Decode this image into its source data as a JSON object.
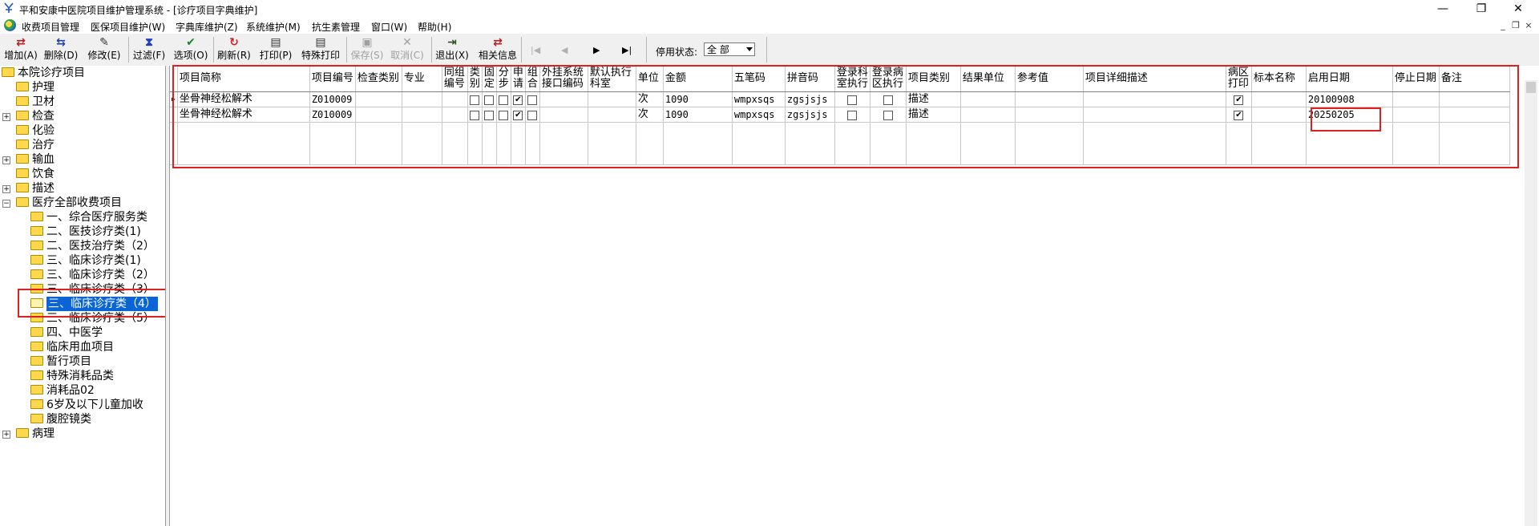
{
  "window": {
    "title": "平和安康中医院项目维护管理系统 - [诊疗项目字典维护]",
    "minimize": "—",
    "restore": "❐",
    "close": "✕"
  },
  "menu": {
    "items": [
      "收费项目管理",
      "医保项目维护(W)",
      "字典库维护(Z)",
      "系统维护(M)",
      "抗生素管理",
      "窗口(W)",
      "帮助(H)"
    ],
    "mdi_min": "_",
    "mdi_restore": "❐",
    "mdi_close": "×"
  },
  "toolbar": {
    "buttons": [
      {
        "label": "增加(A)",
        "icon": "add-icon",
        "glyph": "⇄"
      },
      {
        "label": "删除(D)",
        "icon": "delete-icon",
        "glyph": "⇆"
      },
      {
        "label": "修改(E)",
        "icon": "edit-icon",
        "glyph": "✎"
      },
      {
        "label": "过滤(F)",
        "icon": "filter-icon",
        "glyph": "⧗"
      },
      {
        "label": "选项(O)",
        "icon": "options-icon",
        "glyph": "✔"
      },
      {
        "label": "刷新(R)",
        "icon": "refresh-icon",
        "glyph": "↻"
      },
      {
        "label": "打印(P)",
        "icon": "print-icon",
        "glyph": "▤"
      },
      {
        "label": "特殊打印",
        "icon": "special-print-icon",
        "glyph": "▤"
      },
      {
        "label": "保存(S)",
        "icon": "save-icon",
        "glyph": "▣"
      },
      {
        "label": "取消(C)",
        "icon": "cancel-icon",
        "glyph": "✕"
      },
      {
        "label": "退出(X)",
        "icon": "exit-icon",
        "glyph": "⇥"
      },
      {
        "label": "相关信息",
        "icon": "related-info-icon",
        "glyph": "⇄"
      }
    ],
    "nav": [
      "|◀",
      "◀",
      "▶",
      "▶|"
    ],
    "status_label": "停用状态:",
    "status_value": "全 部"
  },
  "tree": {
    "root": "本院诊疗项目",
    "items": [
      {
        "label": "护理",
        "expandable": false
      },
      {
        "label": "卫材",
        "expandable": false
      },
      {
        "label": "检查",
        "expandable": true,
        "expanded": false
      },
      {
        "label": "化验",
        "expandable": false
      },
      {
        "label": "治疗",
        "expandable": false
      },
      {
        "label": "输血",
        "expandable": true,
        "expanded": false
      },
      {
        "label": "饮食",
        "expandable": false
      },
      {
        "label": "描述",
        "expandable": true,
        "expanded": false
      },
      {
        "label": "医疗全部收费项目",
        "expandable": true,
        "expanded": true
      }
    ],
    "children": [
      "一、综合医疗服务类",
      "二、医技诊疗类(1)",
      "二、医技治疗类（2）",
      "三、临床诊疗类(1)",
      "三、临床诊疗类（2）",
      "三、临床诊疗类（3）",
      "三、临床诊疗类（4）",
      "三、临床诊疗类（5）",
      "四、中医学",
      "临床用血项目",
      "暂行项目",
      "特殊消耗品类",
      "消耗品02",
      "6岁及以下儿童加收",
      "腹腔镜类"
    ],
    "selected_child_index": 6,
    "last": {
      "label": "病理",
      "expandable": true,
      "expanded": false
    }
  },
  "grid": {
    "columns": [
      "项目简称",
      "项目编号",
      "检查类别",
      "专业",
      "同组编号",
      "类别",
      "固定",
      "分步",
      "申请",
      "组合",
      "外挂系统接口编码",
      "默认执行科室",
      "单位",
      "金额",
      "五笔码",
      "拼音码",
      "登录科室执行",
      "登录病区执行",
      "项目类别",
      "结果单位",
      "参考值",
      "项目详细描述",
      "病区打印",
      "标本名称",
      "启用日期",
      "停止日期",
      "备注"
    ],
    "rows": [
      {
        "name": "坐骨神经松解术",
        "code": "Z010009",
        "cat": false,
        "fixed": false,
        "step": false,
        "apply": true,
        "combo": false,
        "unit": "次",
        "amount": "1090",
        "wubi": "wmpxsqs",
        "pinyin": "zgsjsjs",
        "login_dept": false,
        "login_ward": false,
        "item_type": "描述",
        "ward_print": true,
        "start_date": "20100908"
      },
      {
        "name": "坐骨神经松解术",
        "code": "Z010009",
        "cat": false,
        "fixed": false,
        "step": false,
        "apply": true,
        "combo": false,
        "unit": "次",
        "amount": "1090",
        "wubi": "wmpxsqs",
        "pinyin": "zgsjsjs",
        "login_dept": false,
        "login_ward": false,
        "item_type": "描述",
        "ward_print": true,
        "start_date": "20250205"
      }
    ]
  },
  "colors": {
    "highlight": "#e02020",
    "selection": "#0a64d6",
    "folder": "#ffd84d"
  }
}
